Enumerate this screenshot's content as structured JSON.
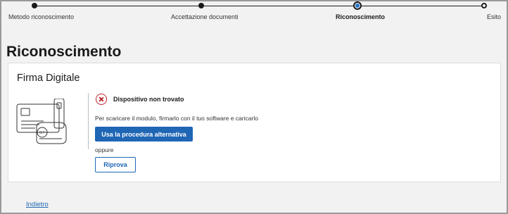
{
  "stepper": {
    "steps": [
      {
        "label": "Metodo riconoscimento",
        "state": "done"
      },
      {
        "label": "Accettazione documenti",
        "state": "done"
      },
      {
        "label": "Riconoscimento",
        "state": "current"
      },
      {
        "label": "Esito",
        "state": "pending"
      }
    ]
  },
  "page": {
    "title": "Riconoscimento"
  },
  "card": {
    "title": "Firma Digitale",
    "illustration_icon": "smartcard-reader-usb-token-illustration",
    "error": {
      "icon": "error-x-circle-icon",
      "text": "Dispositivo non trovato",
      "color": "#c0262d"
    },
    "hint": "Per scaricare il modulo, firmarlo con il tuo software e caricarlo",
    "primary_button": "Usa la procedura alternativa",
    "separator": "oppure",
    "retry_button": "Riprova"
  },
  "footer": {
    "back_link": "Indietro"
  },
  "colors": {
    "accent": "#1f66b5",
    "current_step": "#2a74c9",
    "background": "#f2f2f2"
  }
}
